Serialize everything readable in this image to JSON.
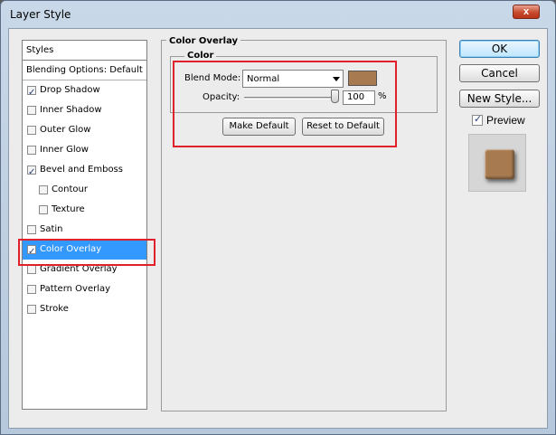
{
  "window": {
    "title": "Layer Style",
    "close_glyph": "x"
  },
  "style_list": {
    "header": "Styles",
    "items": [
      {
        "label": "Blending Options: Default",
        "has_checkbox": false,
        "checked": false,
        "indent": false,
        "selected": false
      },
      {
        "label": "Drop Shadow",
        "has_checkbox": true,
        "checked": true,
        "indent": false,
        "selected": false
      },
      {
        "label": "Inner Shadow",
        "has_checkbox": true,
        "checked": false,
        "indent": false,
        "selected": false
      },
      {
        "label": "Outer Glow",
        "has_checkbox": true,
        "checked": false,
        "indent": false,
        "selected": false
      },
      {
        "label": "Inner Glow",
        "has_checkbox": true,
        "checked": false,
        "indent": false,
        "selected": false
      },
      {
        "label": "Bevel and Emboss",
        "has_checkbox": true,
        "checked": true,
        "indent": false,
        "selected": false
      },
      {
        "label": "Contour",
        "has_checkbox": true,
        "checked": false,
        "indent": true,
        "selected": false
      },
      {
        "label": "Texture",
        "has_checkbox": true,
        "checked": false,
        "indent": true,
        "selected": false
      },
      {
        "label": "Satin",
        "has_checkbox": true,
        "checked": false,
        "indent": false,
        "selected": false
      },
      {
        "label": "Color Overlay",
        "has_checkbox": true,
        "checked": true,
        "indent": false,
        "selected": true
      },
      {
        "label": "Gradient Overlay",
        "has_checkbox": true,
        "checked": false,
        "indent": false,
        "selected": false
      },
      {
        "label": "Pattern Overlay",
        "has_checkbox": true,
        "checked": false,
        "indent": false,
        "selected": false
      },
      {
        "label": "Stroke",
        "has_checkbox": true,
        "checked": false,
        "indent": false,
        "selected": false
      }
    ]
  },
  "color_overlay": {
    "group_title": "Color Overlay",
    "subgroup_title": "Color",
    "blend_mode_label": "Blend Mode:",
    "blend_mode_value": "Normal",
    "overlay_color": "#a87a50",
    "opacity_label": "Opacity:",
    "opacity_value": "100",
    "opacity_unit": "%",
    "opacity_level": 1.0,
    "make_default_label": "Make Default",
    "reset_default_label": "Reset to Default"
  },
  "actions": {
    "ok_label": "OK",
    "cancel_label": "Cancel",
    "new_style_label": "New Style...",
    "preview_label": "Preview",
    "preview_checked": true
  },
  "colors": {
    "selection": "#3399ff",
    "highlight_box": "#e0202a"
  }
}
